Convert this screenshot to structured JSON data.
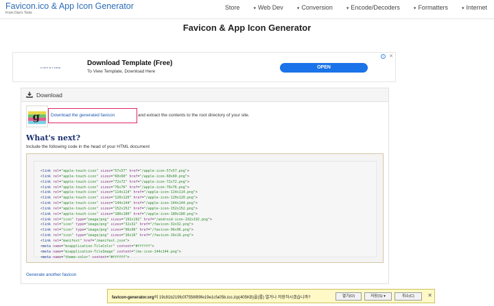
{
  "header": {
    "title": "Favicon.ico & App Icon Generator",
    "subtitle": "From Dan's Tools",
    "nav": [
      {
        "label": "Store",
        "caret": false
      },
      {
        "label": "Web Dev",
        "caret": true
      },
      {
        "label": "Conversion",
        "caret": true
      },
      {
        "label": "Encode/Decoders",
        "caret": true
      },
      {
        "label": "Formatters",
        "caret": true
      },
      {
        "label": "Internet",
        "caret": true
      }
    ]
  },
  "page_title": "Favicon & App Icon Generator",
  "ad": {
    "logo": "ɛ ʟᴇᴄᴛ ɴ ɪ ʏᴏᴜʀ",
    "title": "Download Template (Free)",
    "subtitle": "To View Template, Download Here",
    "button": "OPEN",
    "info": "i",
    "close": "✕"
  },
  "download": {
    "header": "Download",
    "link": "Download the generated favicon",
    "rest": "and extract the contents to the root directory of your site.",
    "whats_next": "What's next?",
    "include": "Include the following code in the head of your HTML document",
    "generate_another": "Generate another favicon"
  },
  "code": [
    {
      "tag": "link",
      "attrs": [
        [
          "rel",
          "apple-touch-icon"
        ],
        [
          "sizes",
          "57x57"
        ],
        [
          "href",
          "/apple-icon-57x57.png"
        ]
      ]
    },
    {
      "tag": "link",
      "attrs": [
        [
          "rel",
          "apple-touch-icon"
        ],
        [
          "sizes",
          "60x60"
        ],
        [
          "href",
          "/apple-icon-60x60.png"
        ]
      ]
    },
    {
      "tag": "link",
      "attrs": [
        [
          "rel",
          "apple-touch-icon"
        ],
        [
          "sizes",
          "72x72"
        ],
        [
          "href",
          "/apple-icon-72x72.png"
        ]
      ]
    },
    {
      "tag": "link",
      "attrs": [
        [
          "rel",
          "apple-touch-icon"
        ],
        [
          "sizes",
          "76x76"
        ],
        [
          "href",
          "/apple-icon-76x76.png"
        ]
      ]
    },
    {
      "tag": "link",
      "attrs": [
        [
          "rel",
          "apple-touch-icon"
        ],
        [
          "sizes",
          "114x114"
        ],
        [
          "href",
          "/apple-icon-114x114.png"
        ]
      ]
    },
    {
      "tag": "link",
      "attrs": [
        [
          "rel",
          "apple-touch-icon"
        ],
        [
          "sizes",
          "120x120"
        ],
        [
          "href",
          "/apple-icon-120x120.png"
        ]
      ]
    },
    {
      "tag": "link",
      "attrs": [
        [
          "rel",
          "apple-touch-icon"
        ],
        [
          "sizes",
          "144x144"
        ],
        [
          "href",
          "/apple-icon-144x144.png"
        ]
      ]
    },
    {
      "tag": "link",
      "attrs": [
        [
          "rel",
          "apple-touch-icon"
        ],
        [
          "sizes",
          "152x152"
        ],
        [
          "href",
          "/apple-icon-152x152.png"
        ]
      ]
    },
    {
      "tag": "link",
      "attrs": [
        [
          "rel",
          "apple-touch-icon"
        ],
        [
          "sizes",
          "180x180"
        ],
        [
          "href",
          "/apple-icon-180x180.png"
        ]
      ]
    },
    {
      "tag": "link",
      "attrs": [
        [
          "rel",
          "icon"
        ],
        [
          "type",
          "image/png"
        ],
        [
          "sizes",
          "192x192"
        ],
        [
          "href",
          "/android-icon-192x192.png"
        ]
      ]
    },
    {
      "tag": "link",
      "attrs": [
        [
          "rel",
          "icon"
        ],
        [
          "type",
          "image/png"
        ],
        [
          "sizes",
          "32x32"
        ],
        [
          "href",
          "/favicon-32x32.png"
        ]
      ]
    },
    {
      "tag": "link",
      "attrs": [
        [
          "rel",
          "icon"
        ],
        [
          "type",
          "image/png"
        ],
        [
          "sizes",
          "96x96"
        ],
        [
          "href",
          "/favicon-96x96.png"
        ]
      ]
    },
    {
      "tag": "link",
      "attrs": [
        [
          "rel",
          "icon"
        ],
        [
          "type",
          "image/png"
        ],
        [
          "sizes",
          "16x16"
        ],
        [
          "href",
          "/favicon-16x16.png"
        ]
      ]
    },
    {
      "tag": "link",
      "attrs": [
        [
          "rel",
          "manifest"
        ],
        [
          "href",
          "/manifest.json"
        ]
      ]
    },
    {
      "tag": "meta",
      "attrs": [
        [
          "name",
          "msapplication-TileColor"
        ],
        [
          "content",
          "#ffffff"
        ]
      ]
    },
    {
      "tag": "meta",
      "attrs": [
        [
          "name",
          "msapplication-TileImage"
        ],
        [
          "content",
          "/ms-icon-144x144.png"
        ]
      ]
    },
    {
      "tag": "meta",
      "attrs": [
        [
          "name",
          "theme-color"
        ],
        [
          "content",
          "#ffffff"
        ]
      ]
    }
  ],
  "download_bar": {
    "filename": "favicon-generator.org",
    "message": "의 19c81b219fc0f7556f89fe19e1cfa05b.ico.zip(405KB)을(를) 열거나 저장하시겠습니까?",
    "open": "열기(O)",
    "save": "저장(S)",
    "save_caret": "▾",
    "cancel": "취소(C)",
    "close": "✕"
  },
  "colors": {
    "brand": "#2a6cb5",
    "link": "#1a56b0",
    "highlight_border": "#e0245e",
    "ad_button": "#1a73e8",
    "heading": "#1b2f6e",
    "download_bar": "#fff9c7"
  }
}
